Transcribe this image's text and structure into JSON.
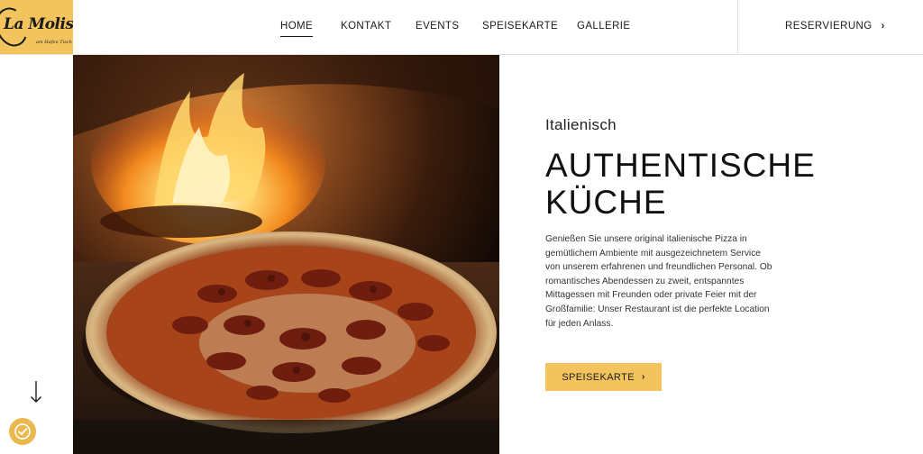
{
  "brand": {
    "name": "La Molisana",
    "tagline": "am Hafen Tisch"
  },
  "nav": {
    "items": [
      {
        "label": "HOME",
        "active": true
      },
      {
        "label": "KONTAKT",
        "active": false
      },
      {
        "label": "EVENTS",
        "active": false
      },
      {
        "label": "SPEISEKARTE",
        "active": false
      },
      {
        "label": "GALLERIE",
        "active": false
      }
    ],
    "reservation_label": "RESERVIERUNG"
  },
  "hero": {
    "kicker": "Italienisch",
    "headline_line1": "AUTHENTISCHE",
    "headline_line2": "KÜCHE",
    "body": "Genießen Sie unsere original italienische Pizza in gemütlichem Ambiente mit ausgezeichnetem Service von unserem erfahrenen und freundlichen Personal. Ob romantisches Abendessen zu zweit, entspanntes Mittagessen mit Freunden oder private Feier mit der Großfamilie: Unser Restaurant ist die perfekte Location für jeden Anlass.",
    "cta_label": "SPEISEKARTE"
  },
  "icons": {
    "scroll": "arrow-down-icon",
    "accessibility": "accessibility-icon",
    "chevron": "chevron-right-icon"
  },
  "colors": {
    "accent": "#f3c45e",
    "text": "#111111",
    "border": "#e4e4e4"
  }
}
